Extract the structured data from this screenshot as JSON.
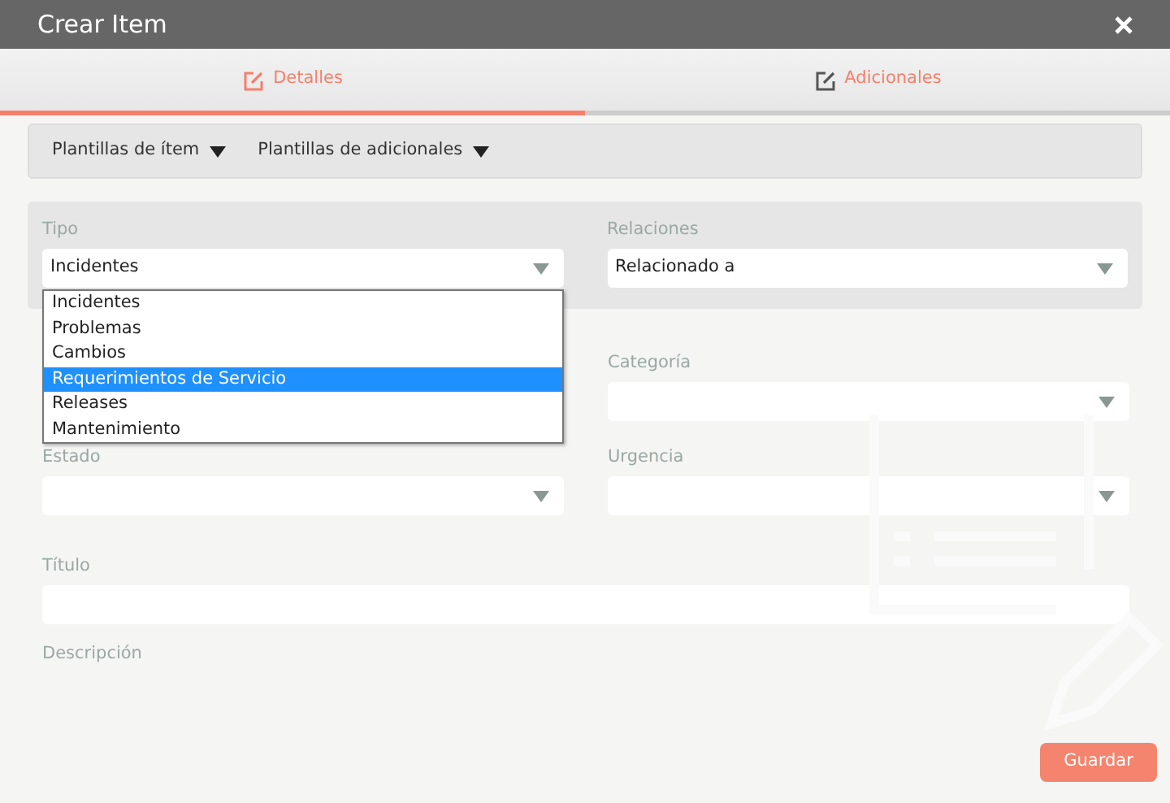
{
  "window": {
    "title": "Crear Item"
  },
  "tabs": [
    {
      "label": "Detalles",
      "selected": true
    },
    {
      "label": "Adicionales",
      "selected": false
    }
  ],
  "templates": [
    "Plantillas de ítem",
    "Plantillas de adicionales"
  ],
  "panel": {
    "left": {
      "label": "Tipo",
      "value": "Incidentes"
    },
    "right": {
      "label": "Relaciones",
      "value": "Relacionado a"
    }
  },
  "rows": [
    {
      "left": null,
      "right": {
        "label": "Categoría"
      }
    },
    {
      "left": {
        "label": "Estado"
      },
      "right": {
        "label": "Urgencia"
      }
    }
  ],
  "title_field": {
    "label": "Título"
  },
  "description": {
    "label": "Descripción"
  },
  "dropdown": {
    "options": [
      {
        "label": "Incidentes",
        "selected": false
      },
      {
        "label": "Problemas",
        "selected": false
      },
      {
        "label": "Cambios",
        "selected": false
      },
      {
        "label": "Requerimientos de Servicio",
        "selected": true
      },
      {
        "label": "Releases",
        "selected": false
      },
      {
        "label": "Mantenimiento",
        "selected": false
      }
    ]
  },
  "save_button": "Guardar"
}
